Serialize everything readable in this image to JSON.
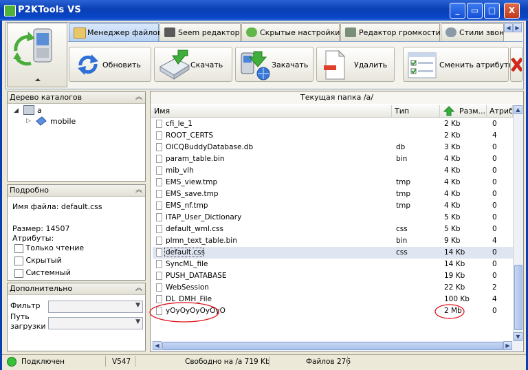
{
  "window": {
    "title": "P2KTools VS",
    "min": "_",
    "restore": "▭",
    "max": "□",
    "close": "X"
  },
  "tabs": [
    {
      "label": "Менеджер файлов",
      "active": true
    },
    {
      "label": "Seem редактор"
    },
    {
      "label": "Скрытые настройки"
    },
    {
      "label": "Редактор громкости"
    },
    {
      "label": "Стили звонка"
    }
  ],
  "toolbar": {
    "refresh": "Обновить",
    "download": "Скачать",
    "upload": "Закачать",
    "delete": "Удалить",
    "attributes": "Сменить атрибуты"
  },
  "tree": {
    "title": "Дерево каталогов",
    "nodes": [
      {
        "label": "a"
      },
      {
        "label": "mobile"
      }
    ]
  },
  "details": {
    "title": "Подробно",
    "filename_label": "Имя файла: default.css",
    "size_label": "Размер: 14507",
    "attrs_label": "Атрибуты:",
    "attrs": [
      "Только чтение",
      "Скрытый",
      "Системный"
    ]
  },
  "extra": {
    "title": "Дополнительно",
    "filter_label": "Фильтр",
    "path_label_1": "Путь",
    "path_label_2": "загрузки"
  },
  "file_list": {
    "current_folder": "Текущая папка /a/",
    "columns": [
      "Имя",
      "Тип",
      "Разм...",
      "Атриб"
    ],
    "rows": [
      {
        "name": "cfi_le_1",
        "type": "",
        "size": "2 Kb",
        "attr": "0"
      },
      {
        "name": "ROOT_CERTS",
        "type": "",
        "size": "2 Kb",
        "attr": "4"
      },
      {
        "name": "OICQBuddyDatabase.db",
        "type": "db",
        "size": "3 Kb",
        "attr": "0"
      },
      {
        "name": "param_table.bin",
        "type": "bin",
        "size": "4 Kb",
        "attr": "0"
      },
      {
        "name": "mib_vlh",
        "type": "",
        "size": "4 Kb",
        "attr": "0"
      },
      {
        "name": "EMS_view.tmp",
        "type": "tmp",
        "size": "4 Kb",
        "attr": "0"
      },
      {
        "name": "EMS_save.tmp",
        "type": "tmp",
        "size": "4 Kb",
        "attr": "0"
      },
      {
        "name": "EMS_nf.tmp",
        "type": "tmp",
        "size": "4 Kb",
        "attr": "0"
      },
      {
        "name": "iTAP_User_Dictionary",
        "type": "",
        "size": "5 Kb",
        "attr": "0"
      },
      {
        "name": "default_wml.css",
        "type": "css",
        "size": "5 Kb",
        "attr": "0"
      },
      {
        "name": "plmn_text_table.bin",
        "type": "bin",
        "size": "9 Kb",
        "attr": "4"
      },
      {
        "name": "default.css",
        "type": "css",
        "size": "14 Kb",
        "attr": "0",
        "selected": true
      },
      {
        "name": "SyncML_file",
        "type": "",
        "size": "14 Kb",
        "attr": "0"
      },
      {
        "name": "PUSH_DATABASE",
        "type": "",
        "size": "19 Kb",
        "attr": "0"
      },
      {
        "name": "WebSession",
        "type": "",
        "size": "22 Kb",
        "attr": "2"
      },
      {
        "name": "DL_DMH_File",
        "type": "",
        "size": "100 Kb",
        "attr": "4"
      },
      {
        "name": "уОуОуОуОуОуО",
        "type": "",
        "size": "2 Mb",
        "attr": "0"
      }
    ]
  },
  "status": {
    "connection": "Подключен",
    "model": "V547",
    "free": "Свободно на /a 719 Kb",
    "files": "Файлов 276"
  },
  "colors": {
    "titlebar": "#0a3fb4",
    "selection": "#dfe6f2",
    "annotation": "#e0101a",
    "connected": "#35c23a"
  }
}
